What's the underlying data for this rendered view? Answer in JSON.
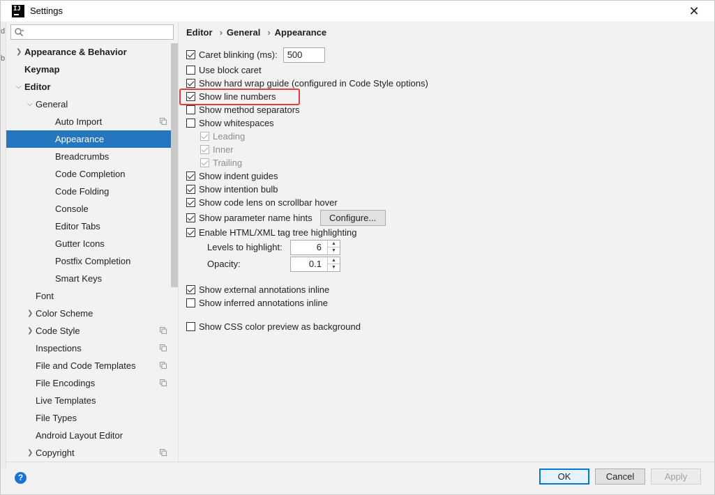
{
  "window": {
    "title": "Settings",
    "app_icon_text": "IJ"
  },
  "edge_chars": [
    "d",
    "b"
  ],
  "search": {
    "placeholder": ""
  },
  "sidebar": {
    "items": [
      {
        "label": "Appearance & Behavior",
        "indent": 0,
        "arrow": "›",
        "bold": true,
        "selected": false,
        "copy_icon": false
      },
      {
        "label": "Keymap",
        "indent": 0,
        "arrow": "",
        "bold": true,
        "selected": false,
        "copy_icon": false
      },
      {
        "label": "Editor",
        "indent": 0,
        "arrow": "⌄",
        "bold": true,
        "selected": false,
        "copy_icon": false
      },
      {
        "label": "General",
        "indent": 1,
        "arrow": "⌄",
        "bold": false,
        "selected": false,
        "copy_icon": false
      },
      {
        "label": "Auto Import",
        "indent": 2,
        "arrow": "",
        "bold": false,
        "selected": false,
        "copy_icon": true
      },
      {
        "label": "Appearance",
        "indent": 2,
        "arrow": "",
        "bold": false,
        "selected": true,
        "copy_icon": false
      },
      {
        "label": "Breadcrumbs",
        "indent": 2,
        "arrow": "",
        "bold": false,
        "selected": false,
        "copy_icon": false
      },
      {
        "label": "Code Completion",
        "indent": 2,
        "arrow": "",
        "bold": false,
        "selected": false,
        "copy_icon": false
      },
      {
        "label": "Code Folding",
        "indent": 2,
        "arrow": "",
        "bold": false,
        "selected": false,
        "copy_icon": false
      },
      {
        "label": "Console",
        "indent": 2,
        "arrow": "",
        "bold": false,
        "selected": false,
        "copy_icon": false
      },
      {
        "label": "Editor Tabs",
        "indent": 2,
        "arrow": "",
        "bold": false,
        "selected": false,
        "copy_icon": false
      },
      {
        "label": "Gutter Icons",
        "indent": 2,
        "arrow": "",
        "bold": false,
        "selected": false,
        "copy_icon": false
      },
      {
        "label": "Postfix Completion",
        "indent": 2,
        "arrow": "",
        "bold": false,
        "selected": false,
        "copy_icon": false
      },
      {
        "label": "Smart Keys",
        "indent": 2,
        "arrow": "",
        "bold": false,
        "selected": false,
        "copy_icon": false
      },
      {
        "label": "Font",
        "indent": 1,
        "arrow": "",
        "bold": false,
        "selected": false,
        "copy_icon": false
      },
      {
        "label": "Color Scheme",
        "indent": 1,
        "arrow": "›",
        "bold": false,
        "selected": false,
        "copy_icon": false
      },
      {
        "label": "Code Style",
        "indent": 1,
        "arrow": "›",
        "bold": false,
        "selected": false,
        "copy_icon": true
      },
      {
        "label": "Inspections",
        "indent": 1,
        "arrow": "",
        "bold": false,
        "selected": false,
        "copy_icon": true
      },
      {
        "label": "File and Code Templates",
        "indent": 1,
        "arrow": "",
        "bold": false,
        "selected": false,
        "copy_icon": true
      },
      {
        "label": "File Encodings",
        "indent": 1,
        "arrow": "",
        "bold": false,
        "selected": false,
        "copy_icon": true
      },
      {
        "label": "Live Templates",
        "indent": 1,
        "arrow": "",
        "bold": false,
        "selected": false,
        "copy_icon": false
      },
      {
        "label": "File Types",
        "indent": 1,
        "arrow": "",
        "bold": false,
        "selected": false,
        "copy_icon": false
      },
      {
        "label": "Android Layout Editor",
        "indent": 1,
        "arrow": "",
        "bold": false,
        "selected": false,
        "copy_icon": false
      },
      {
        "label": "Copyright",
        "indent": 1,
        "arrow": "›",
        "bold": false,
        "selected": false,
        "copy_icon": true
      }
    ]
  },
  "breadcrumb": {
    "part1": "Editor",
    "part2": "General",
    "part3": "Appearance",
    "separator": "›"
  },
  "options": {
    "caret_blinking": {
      "label": "Caret blinking (ms):",
      "checked": true,
      "value": "500"
    },
    "block_caret": {
      "label": "Use block caret",
      "checked": false
    },
    "hard_wrap": {
      "label": "Show hard wrap guide (configured in Code Style options)",
      "checked": true
    },
    "line_numbers": {
      "label": "Show line numbers",
      "checked": true
    },
    "method_separators": {
      "label": "Show method separators",
      "checked": false
    },
    "whitespaces": {
      "label": "Show whitespaces",
      "checked": false
    },
    "leading": {
      "label": "Leading",
      "checked": true
    },
    "inner": {
      "label": "Inner",
      "checked": true
    },
    "trailing": {
      "label": "Trailing",
      "checked": true
    },
    "indent_guides": {
      "label": "Show indent guides",
      "checked": true
    },
    "intention_bulb": {
      "label": "Show intention bulb",
      "checked": true
    },
    "code_lens": {
      "label": "Show code lens on scrollbar hover",
      "checked": true
    },
    "param_hints": {
      "label": "Show parameter name hints",
      "checked": true,
      "button": "Configure..."
    },
    "tag_tree": {
      "label": "Enable HTML/XML tag tree highlighting",
      "checked": true
    },
    "levels": {
      "label": "Levels to highlight:",
      "value": "6"
    },
    "opacity": {
      "label": "Opacity:",
      "value": "0.1"
    },
    "external_annotations": {
      "label": "Show external annotations inline",
      "checked": true
    },
    "inferred_annotations": {
      "label": "Show inferred annotations inline",
      "checked": false
    },
    "css_color": {
      "label": "Show CSS color preview as background",
      "checked": false
    }
  },
  "footer": {
    "help": "?",
    "ok": "OK",
    "cancel": "Cancel",
    "apply": "Apply"
  },
  "colors": {
    "selection": "#2675bf",
    "highlight": "#e83a3a",
    "help": "#1a73d8"
  }
}
